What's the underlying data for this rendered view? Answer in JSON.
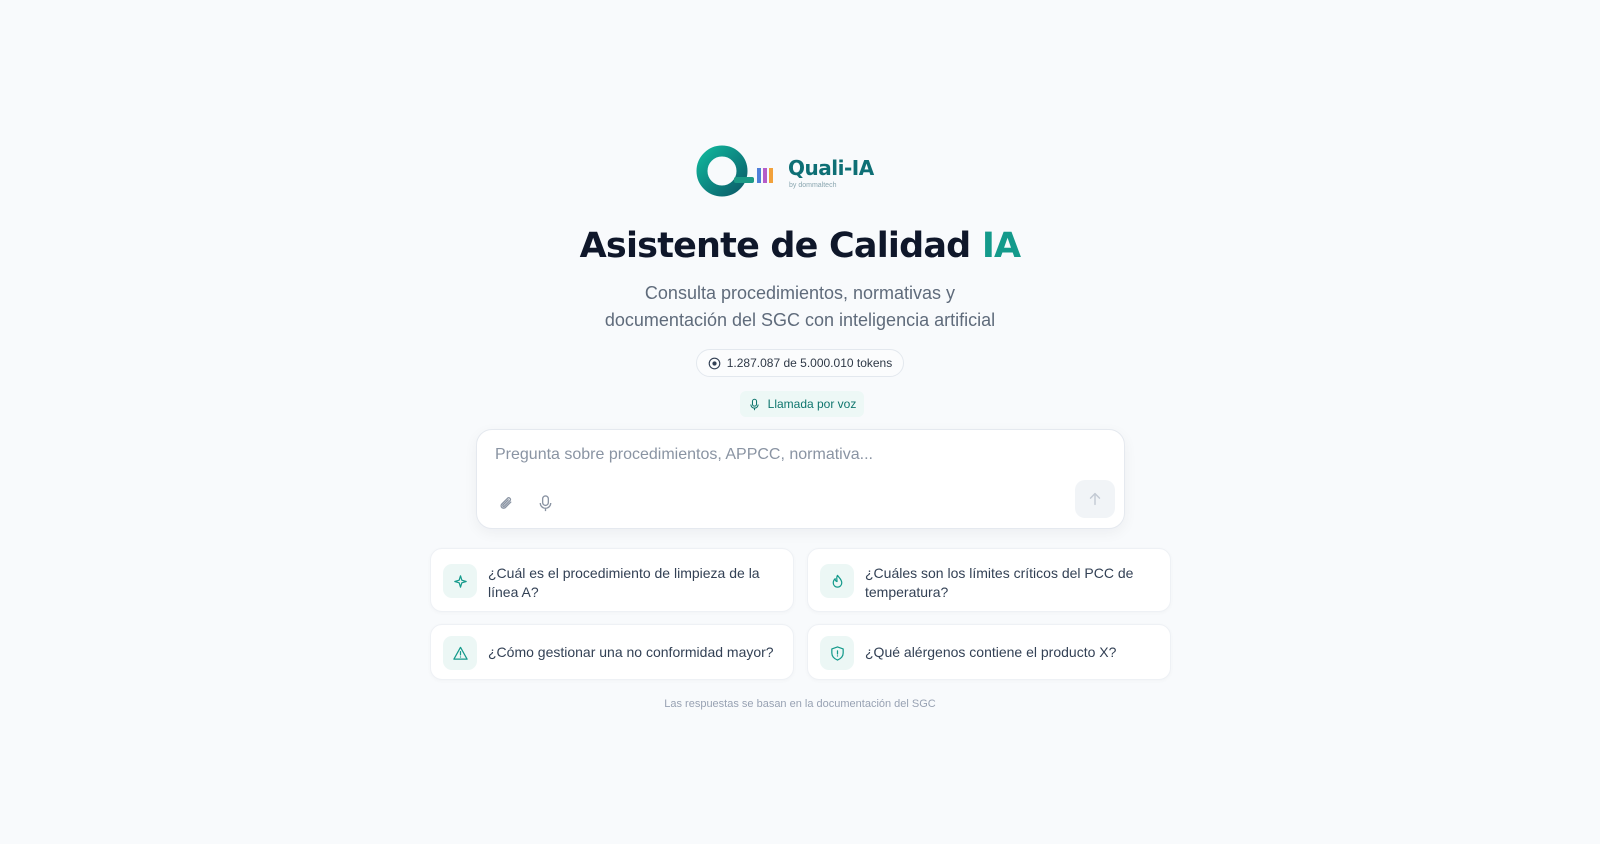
{
  "brand": {
    "logo_text": "Quali-IA",
    "logo_sub": "by dommaltech",
    "colors": {
      "teal": "#149a8b",
      "dark_teal": "#0e6f75",
      "bar1": "#4f7fd9",
      "bar2": "#b45cc9",
      "bar3": "#f2a13b"
    }
  },
  "header": {
    "title_main": "Asistente de Calidad",
    "title_accent": "IA",
    "subtitle_line1": "Consulta procedimientos, normativas y",
    "subtitle_line2": "documentación del SGC con inteligencia artificial"
  },
  "tokens": {
    "icon": "coin-icon",
    "label": "1.287.087 de 5.000.010 tokens"
  },
  "voice": {
    "icon": "microphone-icon",
    "label": "Llamada por voz"
  },
  "composer": {
    "placeholder": "Pregunta sobre procedimientos, APPCC, normativa...",
    "value": "",
    "attach_icon": "paperclip-icon",
    "mic_icon": "microphone-icon",
    "send_icon": "arrow-up-icon"
  },
  "suggestions": [
    {
      "icon": "sparkle-icon",
      "text": "¿Cuál es el procedimiento de limpieza de la línea A?"
    },
    {
      "icon": "flame-icon",
      "text": "¿Cuáles son los límites críticos del PCC de temperatura?"
    },
    {
      "icon": "warning-triangle-icon",
      "text": "¿Cómo gestionar una no conformidad mayor?"
    },
    {
      "icon": "shield-icon",
      "text": "¿Qué alérgenos contiene el producto X?"
    }
  ],
  "footnote": "Las respuestas se basan en la documentación del SGC"
}
